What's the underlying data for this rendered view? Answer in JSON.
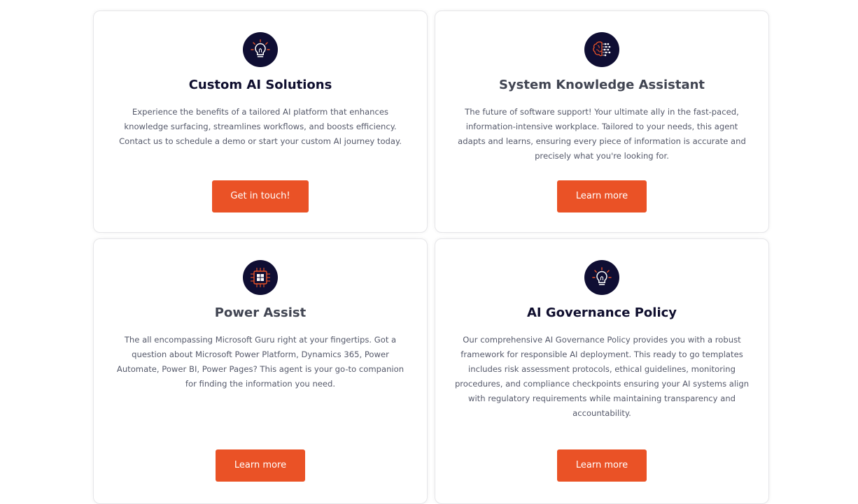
{
  "colors": {
    "accent": "#ea5226",
    "icon_bg": "#0f0e33",
    "title_dark": "#0f0e2e",
    "title_grey": "#414552",
    "body_text": "#55596a",
    "card_border": "#e6e6e9"
  },
  "cards": [
    {
      "icon": "lightbulb-icon",
      "title": "Custom AI Solutions",
      "description": "Experience the benefits of a tailored AI platform that enhances knowledge surfacing, streamlines workflows, and boosts efficiency. Contact us to schedule a demo or start your custom AI journey today.",
      "button_label": "Get in touch!"
    },
    {
      "icon": "brain-network-icon",
      "title": "System Knowledge Assistant",
      "description": "The future of software support! Your ultimate ally in the fast-paced, information-intensive workplace. Tailored to your needs, this agent adapts and learns, ensuring every piece of information is accurate and precisely what you're looking for.",
      "button_label": "Learn more"
    },
    {
      "icon": "microchip-icon",
      "title": "Power Assist",
      "description": "The all encompassing Microsoft Guru right at your fingertips. Got a question about Microsoft Power Platform, Dynamics 365, Power Automate, Power BI, Power Pages? This agent is your go-to companion for finding the information you need.",
      "button_label": "Learn more"
    },
    {
      "icon": "lightbulb-icon",
      "title": "AI Governance Policy",
      "description": "Our comprehensive AI Governance Policy provides you with a robust framework for responsible AI deployment. This ready to go templates includes risk assessment protocols, ethical guidelines, monitoring procedures, and compliance checkpoints ensuring your AI systems align with regulatory requirements while maintaining transparency and accountability.",
      "button_label": "Learn more"
    }
  ]
}
